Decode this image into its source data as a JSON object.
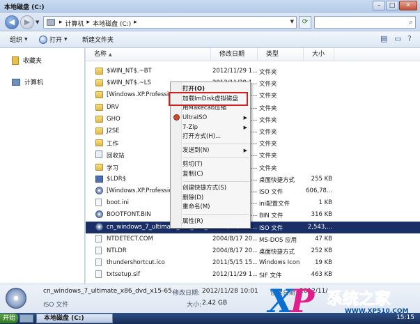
{
  "window": {
    "title": "本地磁盘 (C:)",
    "minimize": "–",
    "maximize": "□",
    "close": "✕"
  },
  "address": {
    "crumbs": [
      "▸",
      "计算机",
      "▸",
      "本地磁盘 (C:)",
      "▸"
    ],
    "search_placeholder": ""
  },
  "toolbar": {
    "organize": "组织",
    "open": "打开",
    "new_folder": "新建文件夹"
  },
  "navpane": {
    "favorites": "收藏夹",
    "computer": "计算机"
  },
  "columns": {
    "name": "名称",
    "date": "修改日期",
    "type": "类型",
    "size": "大小"
  },
  "files": [
    {
      "name": "$WIN_NT$.~BT",
      "date": "2012/11/29 1...",
      "type": "文件夹",
      "size": "",
      "icon": "folder"
    },
    {
      "name": "$WIN_NT$.~LS",
      "date": "2012/11/29 1...",
      "type": "文件夹",
      "size": "",
      "icon": "folder"
    },
    {
      "name": "[Windows.XP.Professional",
      "date": "2012/11/29 1...",
      "type": "文件夹",
      "size": "",
      "icon": "folder"
    },
    {
      "name": "DRV",
      "date": "2012/11/29 1...",
      "type": "文件夹",
      "size": "",
      "icon": "folder"
    },
    {
      "name": "GHO",
      "date": "2012/11/29 1...",
      "type": "文件夹",
      "size": "",
      "icon": "folder"
    },
    {
      "name": "J2SE",
      "date": "2012/11/29 1...",
      "type": "文件夹",
      "size": "",
      "icon": "folder"
    },
    {
      "name": "工作",
      "date": "2012/11/29 1...",
      "type": "文件夹",
      "size": "",
      "icon": "folder"
    },
    {
      "name": "回收站",
      "date": "2012/11/29 1...",
      "type": "文件夹",
      "size": "",
      "icon": "recycle"
    },
    {
      "name": "学习",
      "date": "2012/11/29 1...",
      "type": "文件夹",
      "size": "",
      "icon": "folder"
    },
    {
      "name": "$LDR$",
      "date": "2012/11/29 1...",
      "type": "桌面快捷方式",
      "size": "255 KB",
      "icon": "app"
    },
    {
      "name": "[Windows.XP.Professional",
      "date": "2012/11/29 1...",
      "type": "ISO 文件",
      "size": "606,78...",
      "icon": "disc"
    },
    {
      "name": "boot.ini",
      "date": "2012/11/29 1...",
      "type": "ini配置文件",
      "size": "1 KB",
      "icon": "file"
    },
    {
      "name": "BOOTFONT.BIN",
      "date": "2012/11/29 1...",
      "type": "BIN 文件",
      "size": "316 KB",
      "icon": "disc"
    },
    {
      "name": "cn_windows_7_ultimate_x86_dvd_x1...",
      "date": "2012/11/28 1...",
      "type": "ISO 文件",
      "size": "2,543,...",
      "icon": "disc",
      "selected": true
    },
    {
      "name": "NTDETECT.COM",
      "date": "2004/8/17 20...",
      "type": "MS-DOS 应用",
      "size": "47 KB",
      "icon": "file"
    },
    {
      "name": "NTLDR",
      "date": "2004/8/17 20...",
      "type": "桌面快捷方式",
      "size": "252 KB",
      "icon": "file"
    },
    {
      "name": "thundershortcut.ico",
      "date": "2011/5/15 15...",
      "type": "Windows Icon",
      "size": "19 KB",
      "icon": "file"
    },
    {
      "name": "txtsetup.sif",
      "date": "2012/11/29 1...",
      "type": "SIF 文件",
      "size": "463 KB",
      "icon": "file"
    }
  ],
  "context_menu": {
    "open": "打开(O)",
    "load_imdisk": "加载ImDisk虚拟磁盘",
    "makecab": "用Makecab压缩",
    "ultraiso": "UltraISO",
    "sevenzip": "7-Zip",
    "open_with": "打开方式(H)...",
    "send_to": "发送到(N)",
    "cut": "剪切(T)",
    "copy": "复制(C)",
    "create_shortcut": "创建快捷方式(S)",
    "delete": "删除(D)",
    "rename": "重命名(M)",
    "properties": "属性(R)"
  },
  "details": {
    "filename": "cn_windows_7_ultimate_x86_dvd_x15-65...",
    "filetype": "ISO 文件",
    "modified_label": "修改日期:",
    "modified_value": "2012/11/28 10:01",
    "created_label": "创建日期:",
    "created_value": "2012/11/...",
    "size_label": "大小:",
    "size_value": "2.42 GB"
  },
  "taskbar": {
    "start": "开始",
    "active_window": "本地磁盘 (C:)",
    "clock": "15:15"
  },
  "watermark": {
    "xp_x": "X",
    "xp_p": "P",
    "cn_text": "系统之家",
    "url": "WWW.XP510.COM"
  }
}
